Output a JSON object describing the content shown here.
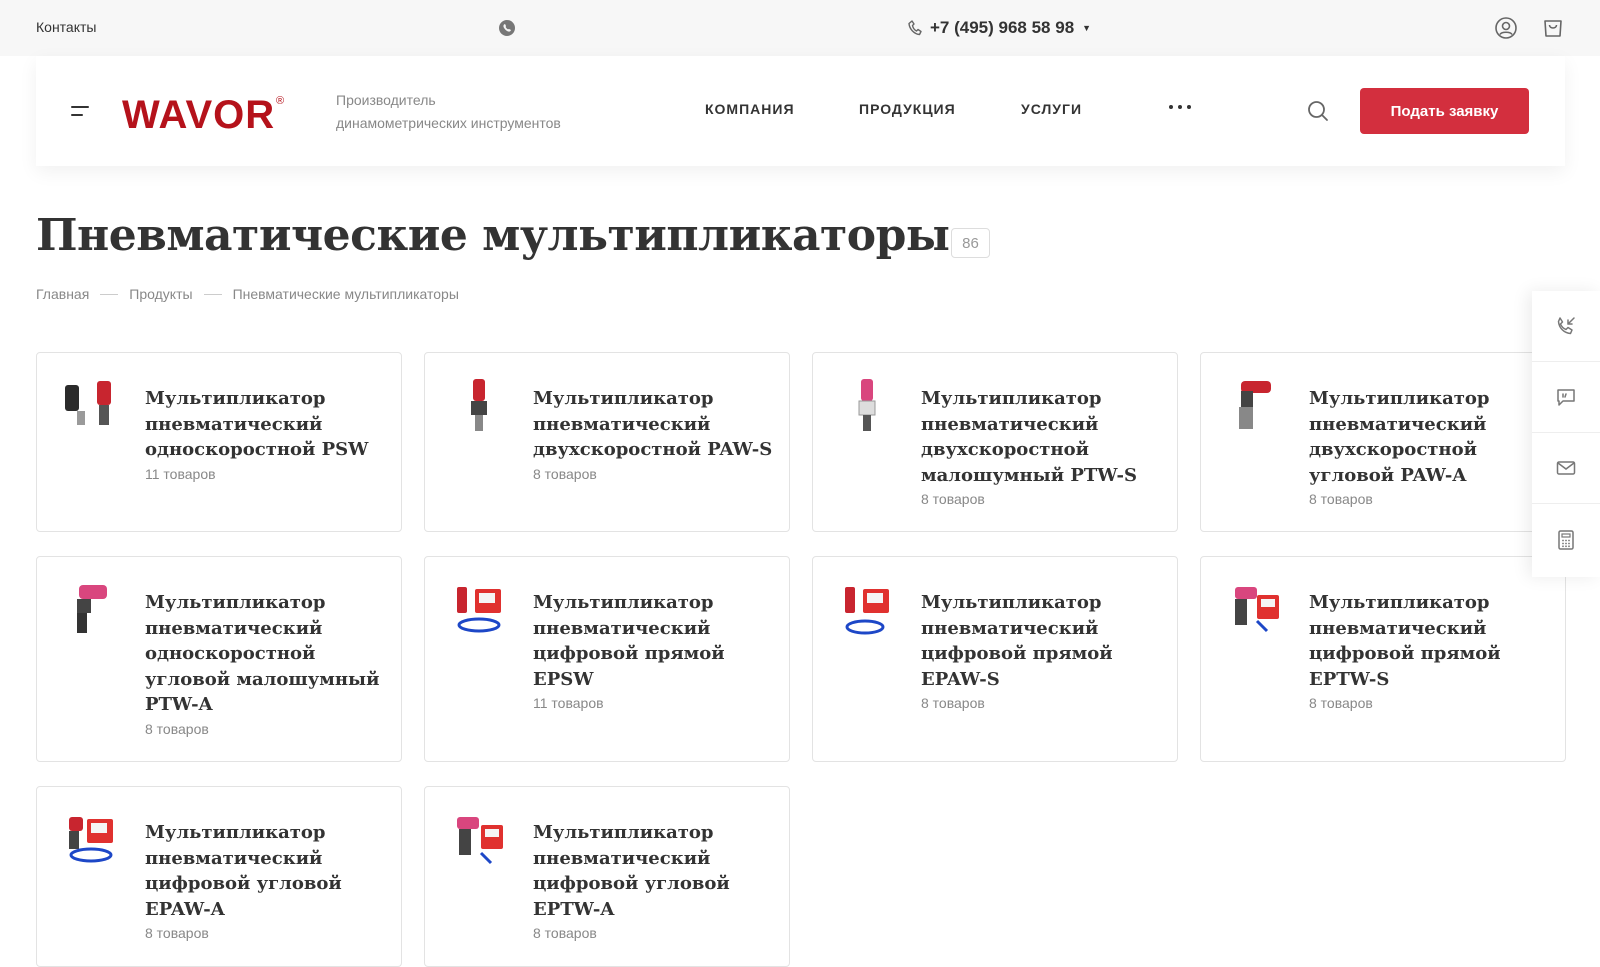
{
  "topbar": {
    "contacts_label": "Контакты",
    "phone": "+7 (495) 968 58 98",
    "icons": [
      "whatsapp-icon",
      "phone-icon",
      "chevron-down-icon",
      "user-icon",
      "cart-icon"
    ]
  },
  "header": {
    "logo_text": "WAVOR",
    "tagline_line1": "Производитель",
    "tagline_line2": "динамометрических инструментов",
    "nav": [
      "КОМПАНИЯ",
      "ПРОДУКЦИЯ",
      "УСЛУГИ"
    ],
    "cta_label": "Подать заявку",
    "icons": [
      "menu-icon",
      "more-icon",
      "search-icon"
    ]
  },
  "page": {
    "title": "Пневматические мультипликаторы",
    "count": "86"
  },
  "breadcrumb": [
    "Главная",
    "Продукты",
    "Пневматические мультипликаторы"
  ],
  "categories": [
    {
      "name": "Мультипликатор пневматический односкоростной PSW",
      "count": "11 товаров"
    },
    {
      "name": "Мультипликатор пневматический двухскоростной PAW-S",
      "count": "8 товаров"
    },
    {
      "name": "Мультипликатор пневматический двухскоростной малошумный PTW-S",
      "count": "8 товаров"
    },
    {
      "name": "Мультипликатор пневматический двухскоростной угловой PAW-A",
      "count": "8 товаров"
    },
    {
      "name": "Мультипликатор пневматический односкоростной угловой малошумный PTW-A",
      "count": "8 товаров"
    },
    {
      "name": "Мультипликатор пневматический цифровой прямой EPSW",
      "count": "11 товаров"
    },
    {
      "name": "Мультипликатор пневматический цифровой прямой EPAW-S",
      "count": "8 товаров"
    },
    {
      "name": "Мультипликатор пневматический цифровой прямой EPTW-S",
      "count": "8 товаров"
    },
    {
      "name": "Мультипликатор пневматический цифровой угловой EPAW-A",
      "count": "8 товаров"
    },
    {
      "name": "Мультипликатор пневматический цифровой угловой EPTW-A",
      "count": "8 товаров"
    }
  ],
  "sidebar_icons": [
    "callback-icon",
    "chat-icon",
    "mail-icon",
    "calculator-icon"
  ],
  "colors": {
    "accent": "#d32f3e",
    "text": "#333333",
    "muted": "#888888"
  }
}
